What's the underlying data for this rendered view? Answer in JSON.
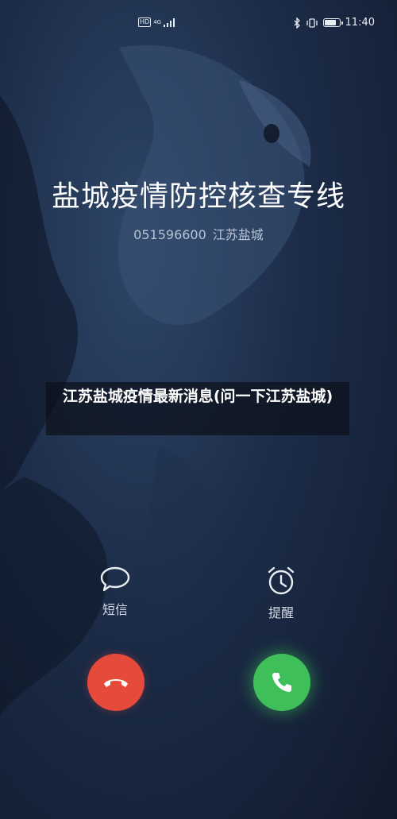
{
  "status_bar": {
    "hd": "HD",
    "network": "4G",
    "time": "11:40",
    "battery_level": 0.85
  },
  "caller": {
    "name": "盐城疫情防控核查专线",
    "number": "051596600",
    "location": "江苏盐城"
  },
  "overlay": {
    "caption": "江苏盐城疫情最新消息(问一下江苏盐城)"
  },
  "actions": {
    "message_label": "短信",
    "remind_label": "提醒"
  },
  "icons": {
    "message": "message-bubble-icon",
    "remind": "alarm-clock-icon",
    "decline": "hang-up-icon",
    "answer": "phone-icon"
  },
  "colors": {
    "decline": "#e54a3b",
    "answer": "#3fbf59"
  }
}
